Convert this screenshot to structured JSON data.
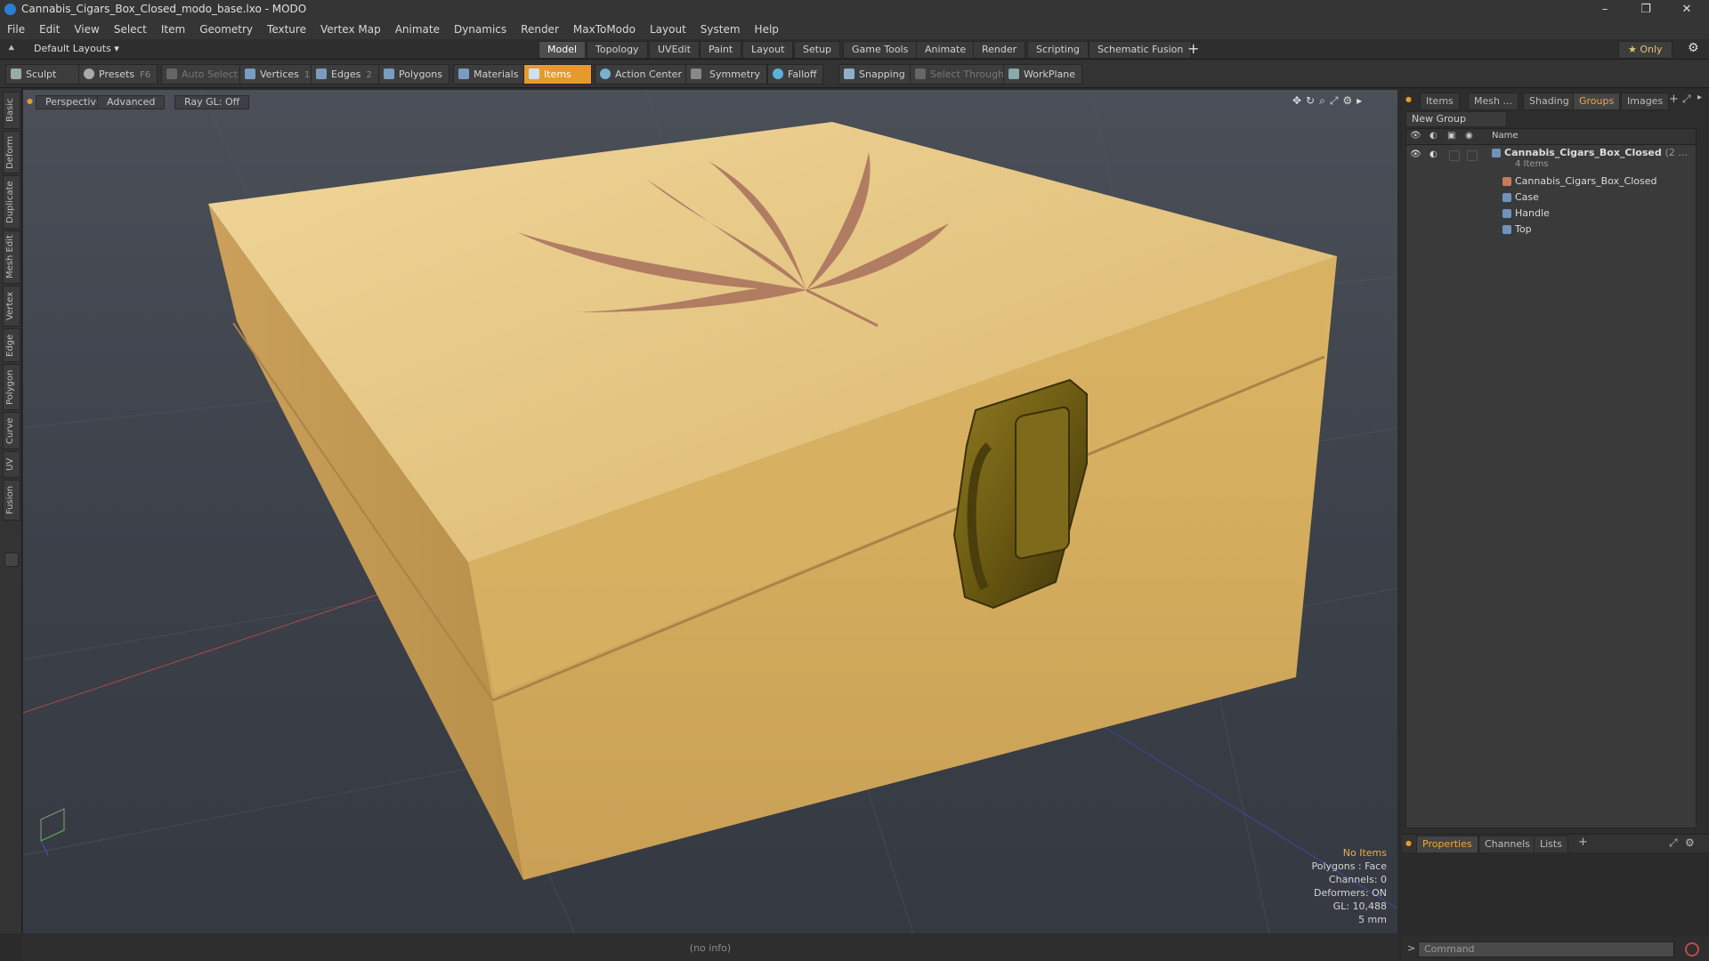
{
  "window": {
    "title": "Cannabis_Cigars_Box_Closed_modo_base.lxo - MODO",
    "minimize": "–",
    "restore": "❐",
    "close": "✕"
  },
  "menu": [
    "File",
    "Edit",
    "View",
    "Select",
    "Item",
    "Geometry",
    "Texture",
    "Vertex Map",
    "Animate",
    "Dynamics",
    "Render",
    "MaxToModo",
    "Layout",
    "System",
    "Help"
  ],
  "layout_bar": {
    "layout_label": "Default Layouts ▾",
    "tabs": [
      "Model",
      "Topology",
      "UVEdit",
      "Paint",
      "Layout",
      "Setup",
      "Game Tools",
      "Animate",
      "Render",
      "Scripting",
      "Schematic Fusion"
    ],
    "active_tab": "Model",
    "add": "+",
    "only": "★ Only",
    "gear": "⚙"
  },
  "toolbar": {
    "sculpt": "Sculpt",
    "presets": "Presets",
    "presets_key": "F6",
    "auto_select": "Auto Select",
    "vertices": "Vertices",
    "vertices_key": "1",
    "edges": "Edges",
    "edges_key": "2",
    "polygons": "Polygons",
    "materials": "Materials",
    "items": "Items",
    "action_center": "Action Center",
    "symmetry": "Symmetry",
    "falloff": "Falloff",
    "snapping": "Snapping",
    "select_through": "Select Through",
    "workplane": "WorkPlane"
  },
  "left_tabs": [
    "Basic",
    "Deform",
    "Duplicate",
    "Mesh Edit",
    "Vertex",
    "Edge",
    "Polygon",
    "Curve",
    "UV",
    "Fusion"
  ],
  "viewport": {
    "perspective": "Perspective",
    "advanced": "Advanced",
    "raygl": "Ray GL: Off",
    "info": {
      "no_items": "No Items",
      "polygons": "Polygons : Face",
      "channels": "Channels: 0",
      "deformers": "Deformers: ON",
      "gl": "GL: 10,488",
      "unit": "5 mm"
    }
  },
  "status": {
    "text": "(no info)"
  },
  "right_panel": {
    "tabs": [
      "Items",
      "Mesh ...",
      "Shading",
      "Groups",
      "Images"
    ],
    "active_tab": "Groups",
    "new_group": "New Group",
    "name_header": "Name",
    "group": {
      "name": "Cannabis_Cigars_Box_Closed",
      "suffix": "(2 ...",
      "count": "4 Items"
    },
    "children": [
      "Cannabis_Cigars_Box_Closed",
      "Case",
      "Handle",
      "Top"
    ],
    "bottom_tabs": [
      "Properties",
      "Channels",
      "Lists"
    ],
    "bottom_active": "Properties",
    "command_placeholder": "Command"
  },
  "colors": {
    "accent": "#e69a2a",
    "wood": "#d9b56b",
    "latch": "#6b5a12"
  }
}
